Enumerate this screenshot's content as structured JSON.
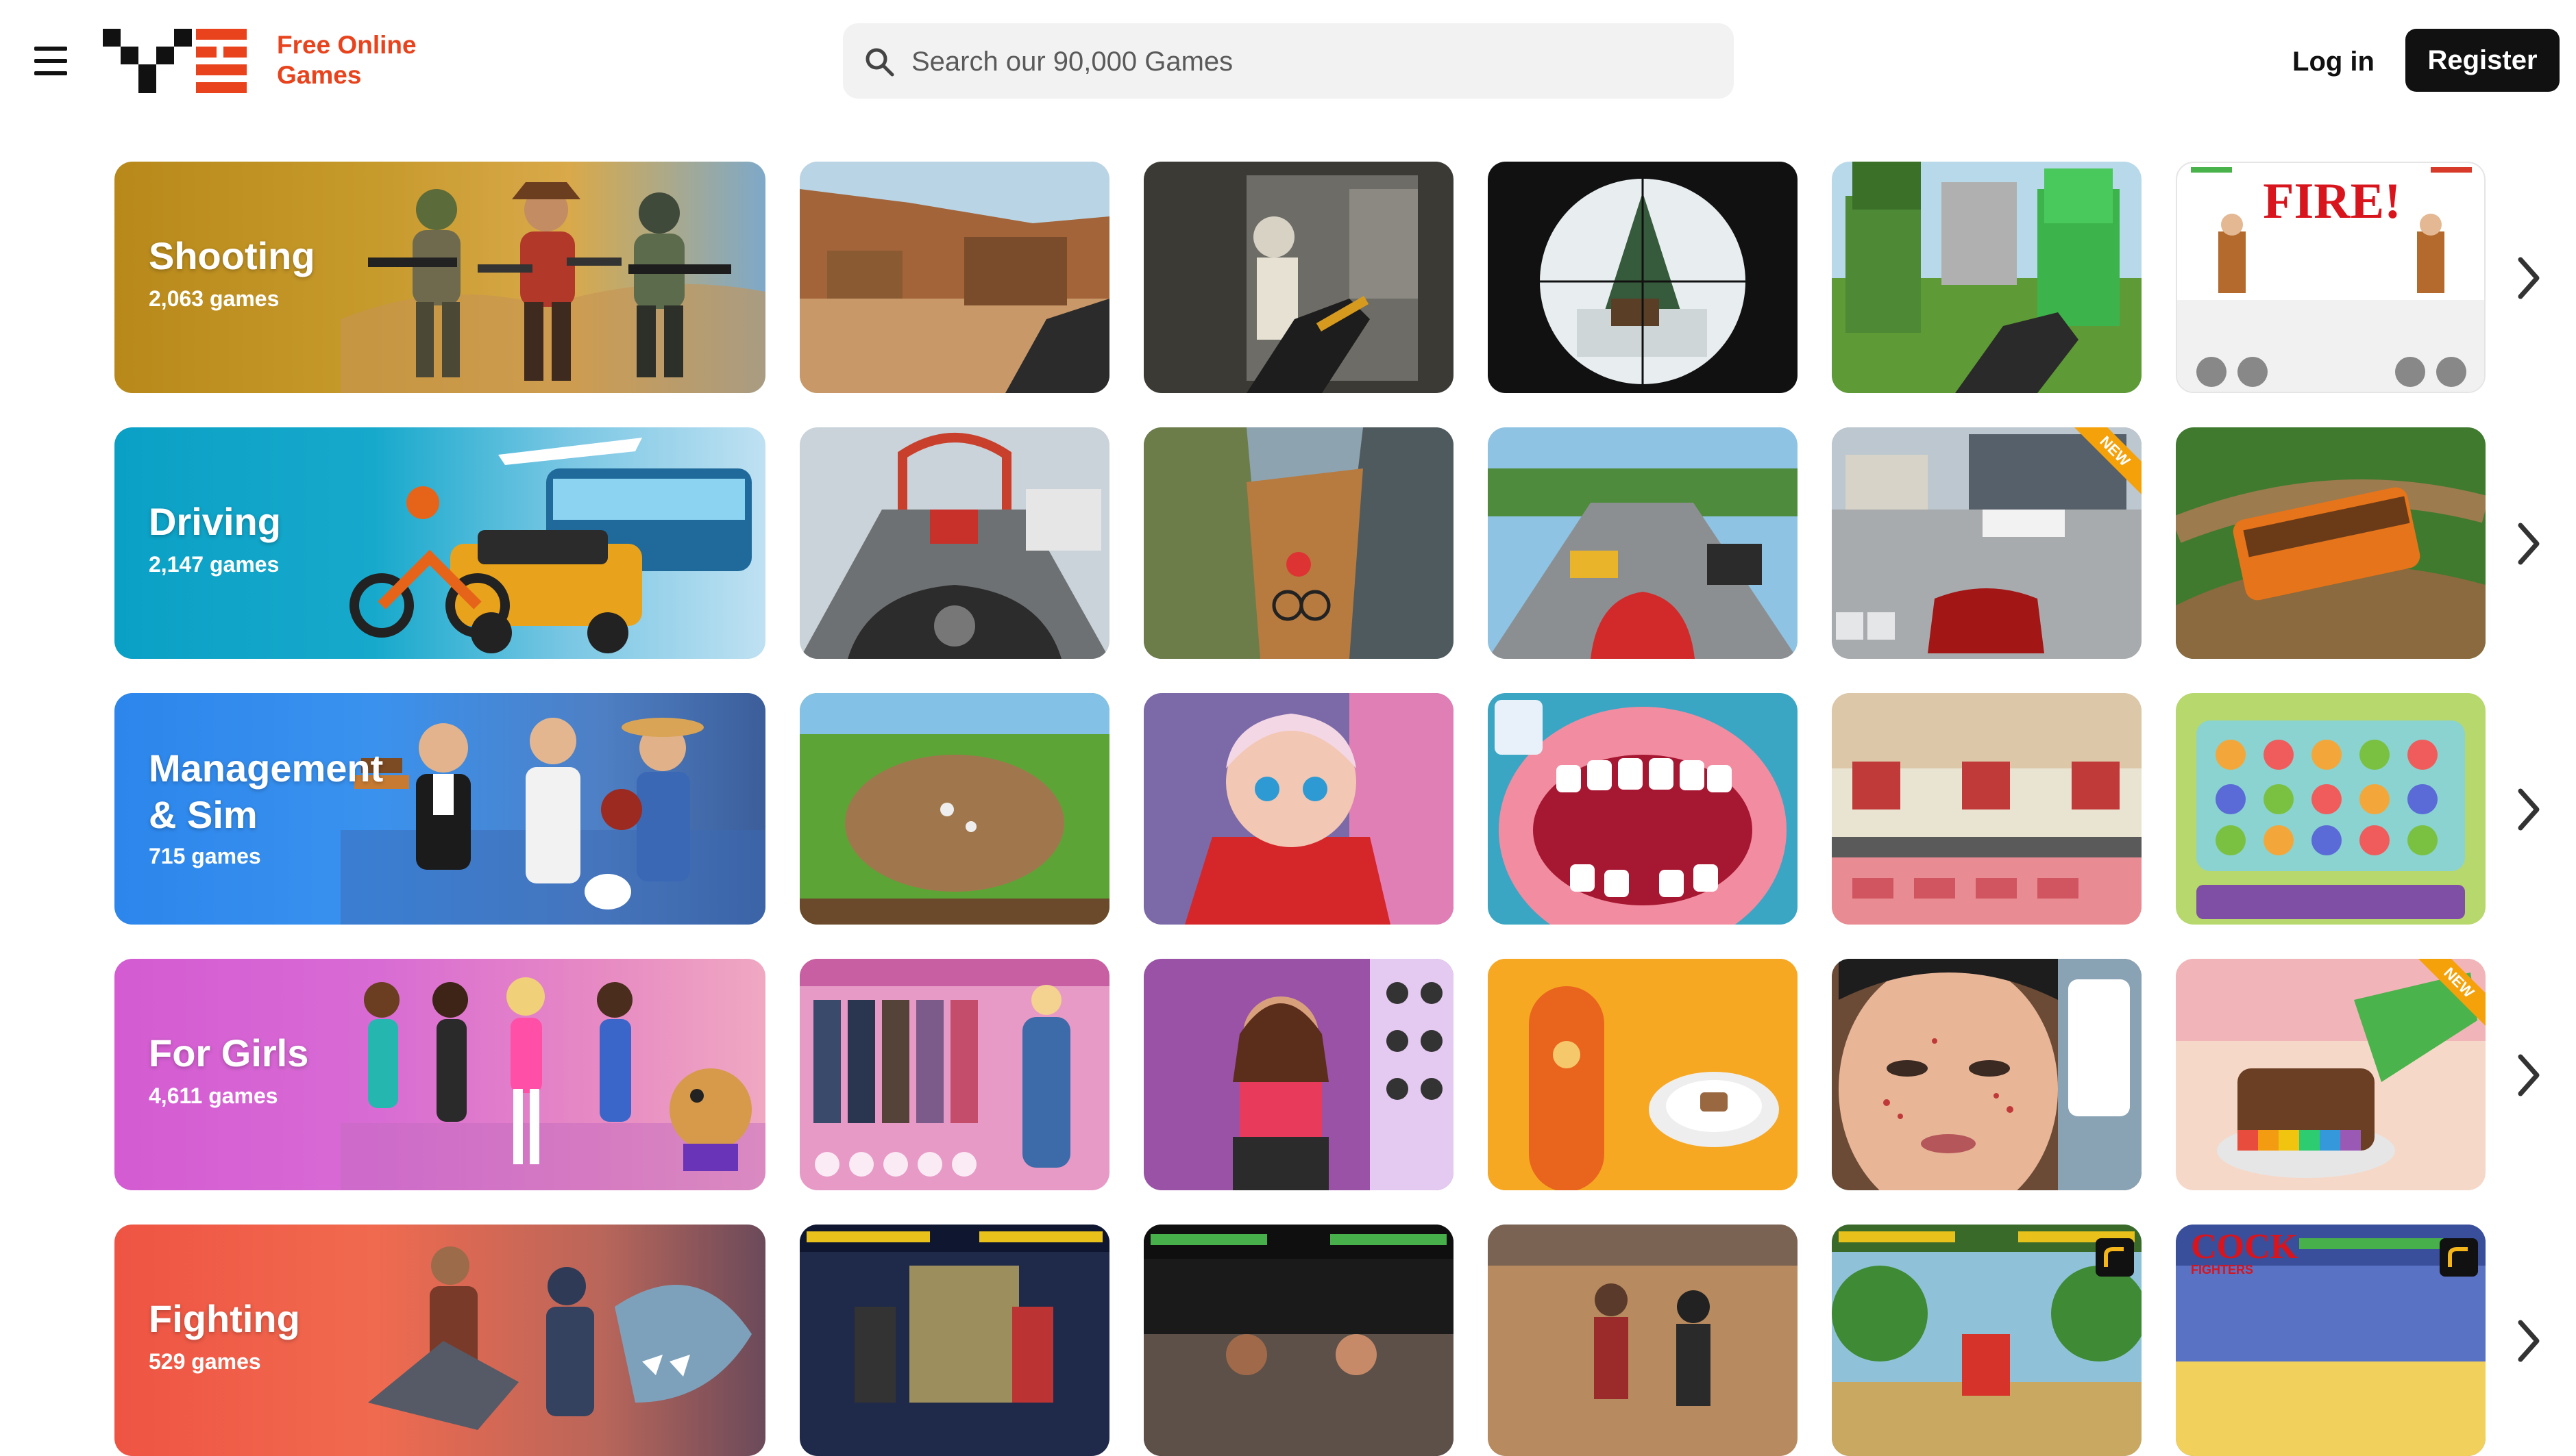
{
  "header": {
    "logo_line1": "Free Online",
    "logo_line2": "Games",
    "search_placeholder": "Search our 90,000 Games",
    "login_label": "Log in",
    "register_label": "Register"
  },
  "categories": [
    {
      "title": "Shooting",
      "count": "2,063 games"
    },
    {
      "title": "Driving",
      "count": "2,147 games"
    },
    {
      "title": "Management\n& Sim",
      "count": "715 games"
    },
    {
      "title": "For Girls",
      "count": "4,611 games"
    },
    {
      "title": "Fighting",
      "count": "529 games"
    }
  ],
  "thumb_text": {
    "fire": "FIRE!",
    "new": "NEW",
    "cock": "COCK",
    "fighters": "FIGHTERS"
  },
  "colors": {
    "brand_red": "#e8431c",
    "shooting": "#b8891a",
    "driving": "#12a6c9",
    "management": "#2f8af0",
    "girls": "#d45bd2",
    "fighting": "#ef5443"
  }
}
